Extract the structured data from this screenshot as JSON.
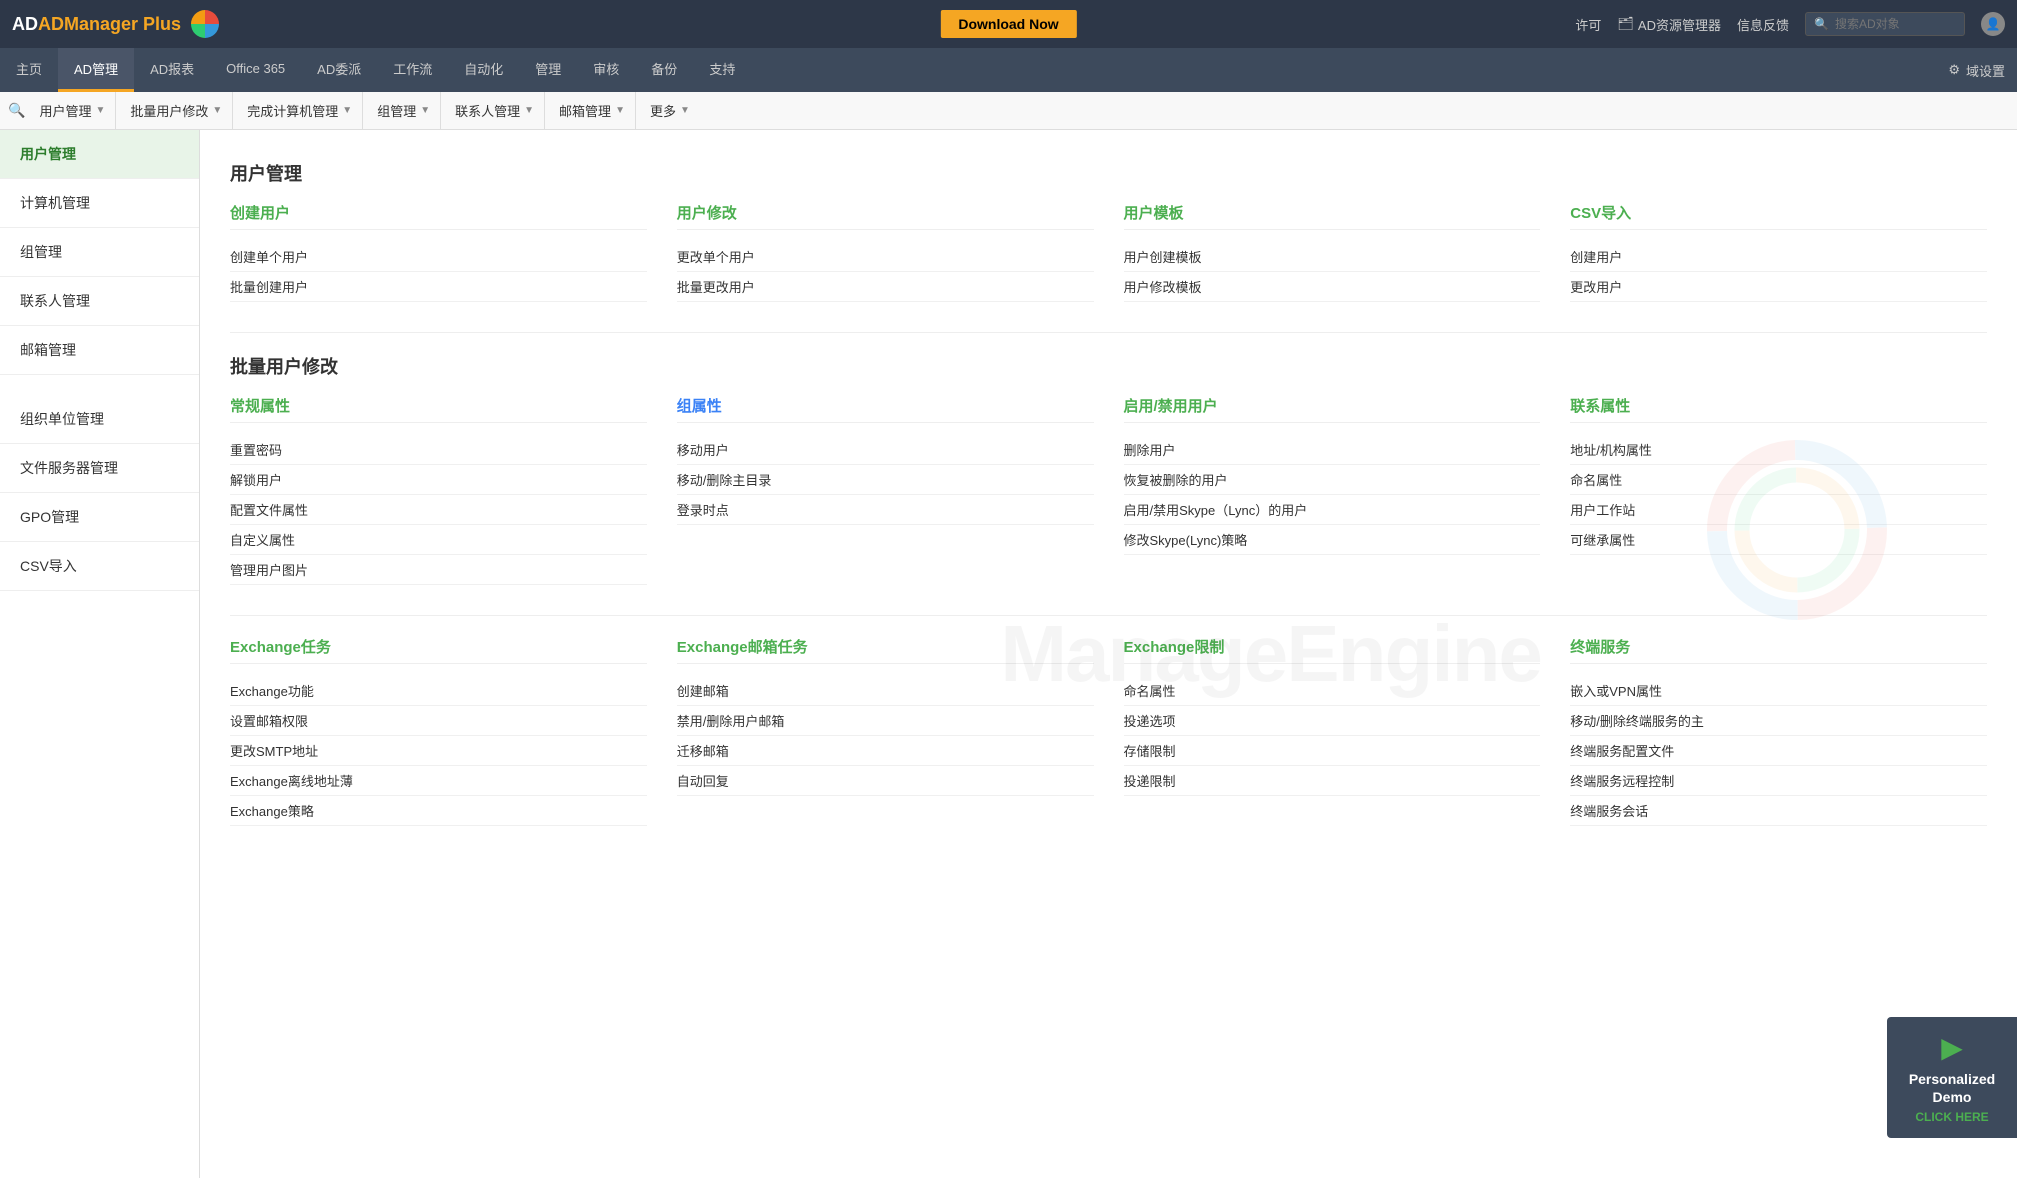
{
  "app": {
    "name": "ADManager Plus",
    "logo_suffix": "Plus"
  },
  "top_bar": {
    "download_btn": "Download Now",
    "search_placeholder": "搜索AD对象",
    "ad_resource": "AD资源管理器",
    "feedback": "信息反馈",
    "permit": "许可"
  },
  "main_nav": {
    "items": [
      {
        "label": "主页",
        "active": false
      },
      {
        "label": "AD管理",
        "active": true
      },
      {
        "label": "AD报表",
        "active": false
      },
      {
        "label": "Office 365",
        "active": false
      },
      {
        "label": "AD委派",
        "active": false
      },
      {
        "label": "工作流",
        "active": false
      },
      {
        "label": "自动化",
        "active": false
      },
      {
        "label": "管理",
        "active": false
      },
      {
        "label": "审核",
        "active": false
      },
      {
        "label": "备份",
        "active": false
      },
      {
        "label": "支持",
        "active": false
      }
    ],
    "settings": "域设置"
  },
  "sub_nav": {
    "items": [
      {
        "label": "用户管理"
      },
      {
        "label": "批量用户修改"
      },
      {
        "label": "完成计算机管理"
      },
      {
        "label": "组管理"
      },
      {
        "label": "联系人管理"
      },
      {
        "label": "邮箱管理"
      },
      {
        "label": "更多"
      }
    ]
  },
  "sidebar": {
    "items": [
      {
        "label": "用户管理",
        "active": true
      },
      {
        "label": "计算机管理",
        "active": false
      },
      {
        "label": "组管理",
        "active": false
      },
      {
        "label": "联系人管理",
        "active": false
      },
      {
        "label": "邮箱管理",
        "active": false
      },
      {
        "label": "",
        "divider": true
      },
      {
        "label": "组织单位管理",
        "active": false
      },
      {
        "label": "文件服务器管理",
        "active": false
      },
      {
        "label": "GPO管理",
        "active": false
      },
      {
        "label": "CSV导入",
        "active": false
      }
    ]
  },
  "content": {
    "page_title": "用户管理",
    "section1": {
      "title": "用户管理",
      "categories": [
        {
          "header": "创建用户",
          "items": [
            "创建单个用户",
            "批量创建用户"
          ]
        },
        {
          "header": "用户修改",
          "items": [
            "更改单个用户",
            "批量更改用户"
          ]
        },
        {
          "header": "用户模板",
          "items": [
            "用户创建模板",
            "用户修改模板"
          ]
        },
        {
          "header": "CSV导入",
          "items": [
            "创建用户",
            "更改用户"
          ]
        }
      ]
    },
    "section2": {
      "title": "批量用户修改",
      "categories": [
        {
          "header": "常规属性",
          "items": [
            "重置密码",
            "解锁用户",
            "配置文件属性",
            "自定义属性",
            "管理用户图片"
          ]
        },
        {
          "header": "组属性",
          "header_blue": true,
          "items": [
            "移动用户",
            "移动/删除主目录",
            "登录时点"
          ]
        },
        {
          "header": "启用/禁用用户",
          "items": [
            "删除用户",
            "恢复被删除的用户",
            "启用/禁用Skype（Lync）的用户",
            "修改Skype(Lync)策略"
          ]
        },
        {
          "header": "联系属性",
          "items": [
            "地址/机构属性",
            "命名属性",
            "用户工作站",
            "可继承属性"
          ]
        }
      ]
    },
    "section3": {
      "categories": [
        {
          "header": "Exchange任务",
          "items": [
            "Exchange功能",
            "设置邮箱权限",
            "更改SMTP地址",
            "Exchange离线地址薄",
            "Exchange策略"
          ]
        },
        {
          "header": "Exchange邮箱任务",
          "items": [
            "创建邮箱",
            "禁用/删除用户邮箱",
            "迁移邮箱",
            "自动回复"
          ]
        },
        {
          "header": "Exchange限制",
          "items": [
            "命名属性",
            "投递选项",
            "存储限制",
            "投递限制"
          ]
        },
        {
          "header": "终端服务",
          "items": [
            "嵌入或VPN属性",
            "移动/删除终端服务的主",
            "终端服务配置文件",
            "终端服务远程控制",
            "终端服务会话"
          ]
        }
      ]
    }
  },
  "demo_widget": {
    "title": "Personalized Demo",
    "click_label": "CLICK HERE"
  },
  "watermark": "ManageEngine"
}
